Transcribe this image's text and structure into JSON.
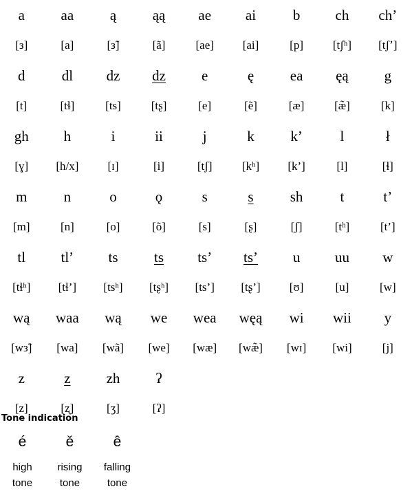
{
  "alphabet_rows": [
    {
      "letters": [
        "a",
        "aa",
        "ą",
        "ąą",
        "ae",
        "ai",
        "b",
        "ch",
        "ch’"
      ],
      "ipa": [
        "[з]",
        "[a]",
        "[з̃]",
        "[ã]",
        "[ae]",
        "[ai]",
        "[p]",
        "[tʃʰ]",
        "[tʃʼ]"
      ]
    },
    {
      "letters": [
        "d",
        "dl",
        "dz",
        "dz",
        "e",
        "ę",
        "ea",
        "ęą",
        "g"
      ],
      "ipa": [
        "[t]",
        "[tɬ]",
        "[ts]",
        "[tʂ]",
        "[e]",
        "[ẽ]",
        "[æ]",
        "[æ̃]",
        "[k]"
      ]
    },
    {
      "letters": [
        "gh",
        "h",
        "i",
        "ii",
        "j",
        "k",
        "k’",
        "l",
        "ł"
      ],
      "ipa": [
        "[ɣ]",
        "[h/x]",
        "[ɪ]",
        "[i]",
        "[tʃ]",
        "[kʰ]",
        "[k’]",
        "[l]",
        "[ɬ]"
      ]
    },
    {
      "letters": [
        "m",
        "n",
        "o",
        "ǫ",
        "s",
        "s",
        "sh",
        "t",
        "t’"
      ],
      "ipa": [
        "[m]",
        "[n]",
        "[o]",
        "[õ]",
        "[s]",
        "[ʂ]",
        "[ʃ]",
        "[tʰ]",
        "[t’]"
      ]
    },
    {
      "letters": [
        "tl",
        "tl’",
        "ts",
        "ts",
        "ts’",
        "ts’",
        "u",
        "uu",
        "w"
      ],
      "ipa": [
        "[tɬʰ]",
        "[tɬ’]",
        "[tsʰ]",
        "[tʂʰ]",
        "[ts’]",
        "[tʂ’]",
        "[ʊ]",
        "[u]",
        "[w]"
      ]
    },
    {
      "letters": [
        "wą",
        "waa",
        "wą",
        "we",
        "wea",
        "węą",
        "wi",
        "wii",
        "y"
      ],
      "ipa": [
        "[wз̃]",
        "[wa]",
        "[wã]",
        "[we]",
        "[wæ]",
        "[wæ̃]",
        "[wɪ]",
        "[wi]",
        "[j]"
      ]
    },
    {
      "letters": [
        "z",
        "z",
        "zh",
        "ʔ",
        "",
        "",
        "",
        "",
        ""
      ],
      "ipa": [
        "[z]",
        "[ʐ]",
        "[ʒ]",
        "[ʔ]",
        "",
        "",
        "",
        "",
        ""
      ]
    }
  ],
  "tone_section": {
    "heading": "Tone indication",
    "marks": [
      "é",
      "ě",
      "ê"
    ],
    "labels": [
      {
        "line1": "high",
        "line2": "tone"
      },
      {
        "line1": "rising",
        "line2": "tone"
      },
      {
        "line1": "falling",
        "line2": "tone"
      }
    ]
  }
}
